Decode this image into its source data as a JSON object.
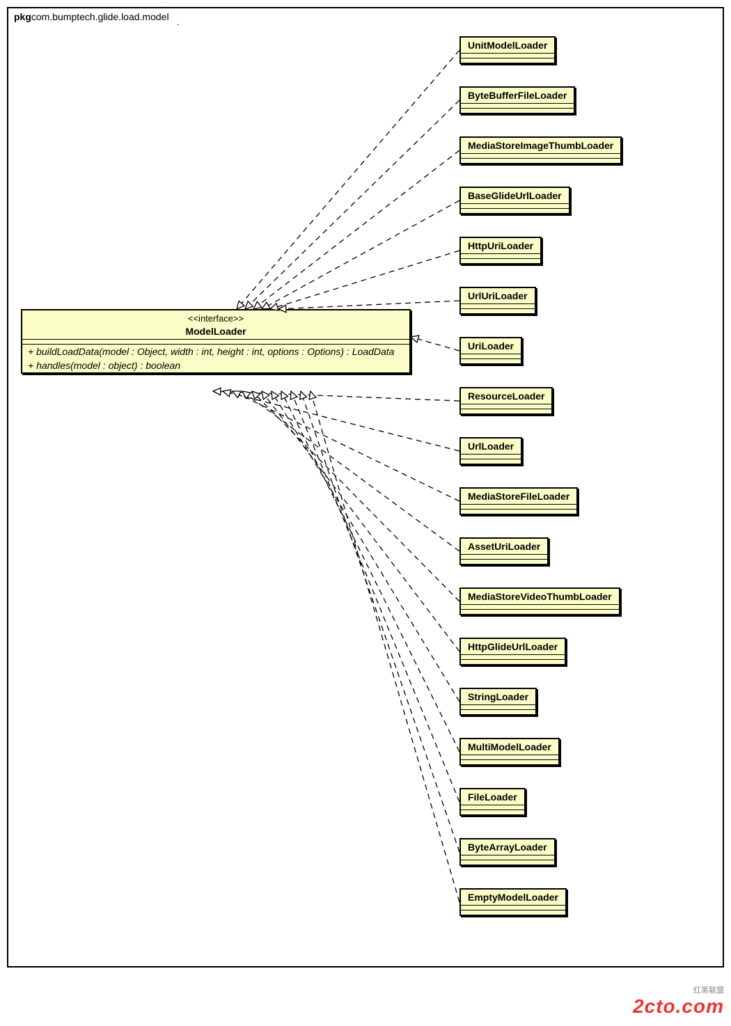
{
  "package": {
    "prefix": "pkg",
    "name": "com.bumptech.glide.load.model"
  },
  "interface": {
    "stereotype": "<<interface>>",
    "name": "ModelLoader",
    "methods": [
      "+ buildLoadData(model : Object, width : int, height : int, options : Options) : LoadData",
      "+ handles(model : object) : boolean"
    ]
  },
  "implementors": [
    {
      "name": "UnitModelLoader"
    },
    {
      "name": "ByteBufferFileLoader"
    },
    {
      "name": "MediaStoreImageThumbLoader"
    },
    {
      "name": "BaseGlideUrlLoader"
    },
    {
      "name": "HttpUriLoader"
    },
    {
      "name": "UrlUriLoader"
    },
    {
      "name": "UriLoader"
    },
    {
      "name": "ResourceLoader"
    },
    {
      "name": "UrlLoader"
    },
    {
      "name": "MediaStoreFileLoader"
    },
    {
      "name": "AssetUriLoader"
    },
    {
      "name": "MediaStoreVideoThumbLoader"
    },
    {
      "name": "HttpGlideUrlLoader"
    },
    {
      "name": "StringLoader"
    },
    {
      "name": "MultiModelLoader"
    },
    {
      "name": "FileLoader"
    },
    {
      "name": "ByteArrayLoader"
    },
    {
      "name": "EmptyModelLoader"
    }
  ],
  "watermark": {
    "main": "2cto.com",
    "sub": "红黑联盟"
  }
}
